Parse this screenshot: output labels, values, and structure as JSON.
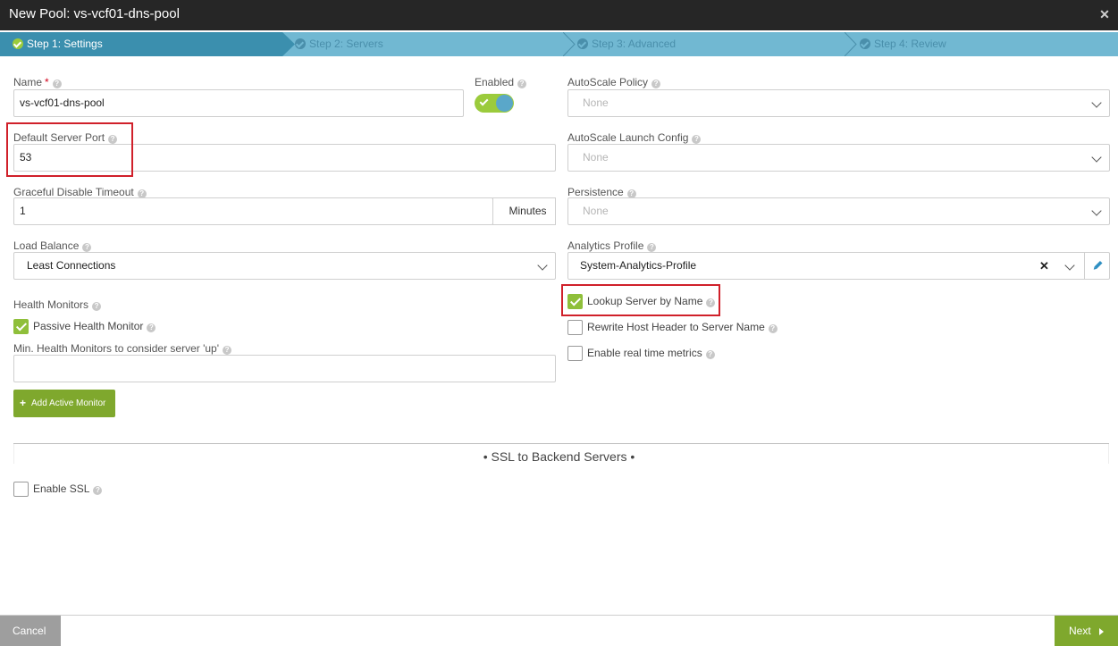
{
  "dialog": {
    "title": "New Pool: vs-vcf01-dns-pool",
    "close_glyph": "✕"
  },
  "steps": [
    {
      "label": "Step 1: Settings",
      "active": true
    },
    {
      "label": "Step 2: Servers",
      "active": false
    },
    {
      "label": "Step 3: Advanced",
      "active": false
    },
    {
      "label": "Step 4: Review",
      "active": false
    }
  ],
  "form": {
    "name": {
      "label": "Name",
      "required_mark": "*",
      "value": "vs-vcf01-dns-pool"
    },
    "enabled": {
      "label": "Enabled",
      "on": true
    },
    "default_server_port": {
      "label": "Default Server Port",
      "value": "53"
    },
    "graceful_disable_timeout": {
      "label": "Graceful Disable Timeout",
      "value": "1",
      "unit": "Minutes"
    },
    "load_balance": {
      "label": "Load Balance",
      "value": "Least Connections"
    },
    "health_monitors": {
      "label": "Health Monitors",
      "passive_label": "Passive Health Monitor",
      "passive_checked": true,
      "min_label": "Min. Health Monitors to consider server 'up'",
      "min_value": "",
      "add_button": "Add Active Monitor"
    },
    "autoscale_policy": {
      "label": "AutoScale Policy",
      "value": "None"
    },
    "autoscale_launch_config": {
      "label": "AutoScale Launch Config",
      "value": "None"
    },
    "persistence": {
      "label": "Persistence",
      "value": "None"
    },
    "analytics_profile": {
      "label": "Analytics Profile",
      "value": "System-Analytics-Profile"
    },
    "lookup_server_by_name": {
      "label": "Lookup Server by Name",
      "checked": true
    },
    "rewrite_host_header": {
      "label": "Rewrite Host Header to Server Name",
      "checked": false
    },
    "realtime_metrics": {
      "label": "Enable real time metrics",
      "checked": false
    }
  },
  "ssl": {
    "section_title": "•  SSL to Backend Servers  •",
    "enable_label": "Enable SSL",
    "enable_checked": false
  },
  "footer": {
    "cancel": "Cancel",
    "next": "Next"
  },
  "colors": {
    "titlebar": "#262626",
    "steps_bar": "#71b8d2",
    "step_active": "#3b8fae",
    "accent_green": "#7fa82d",
    "highlight_red": "#d0202a"
  }
}
